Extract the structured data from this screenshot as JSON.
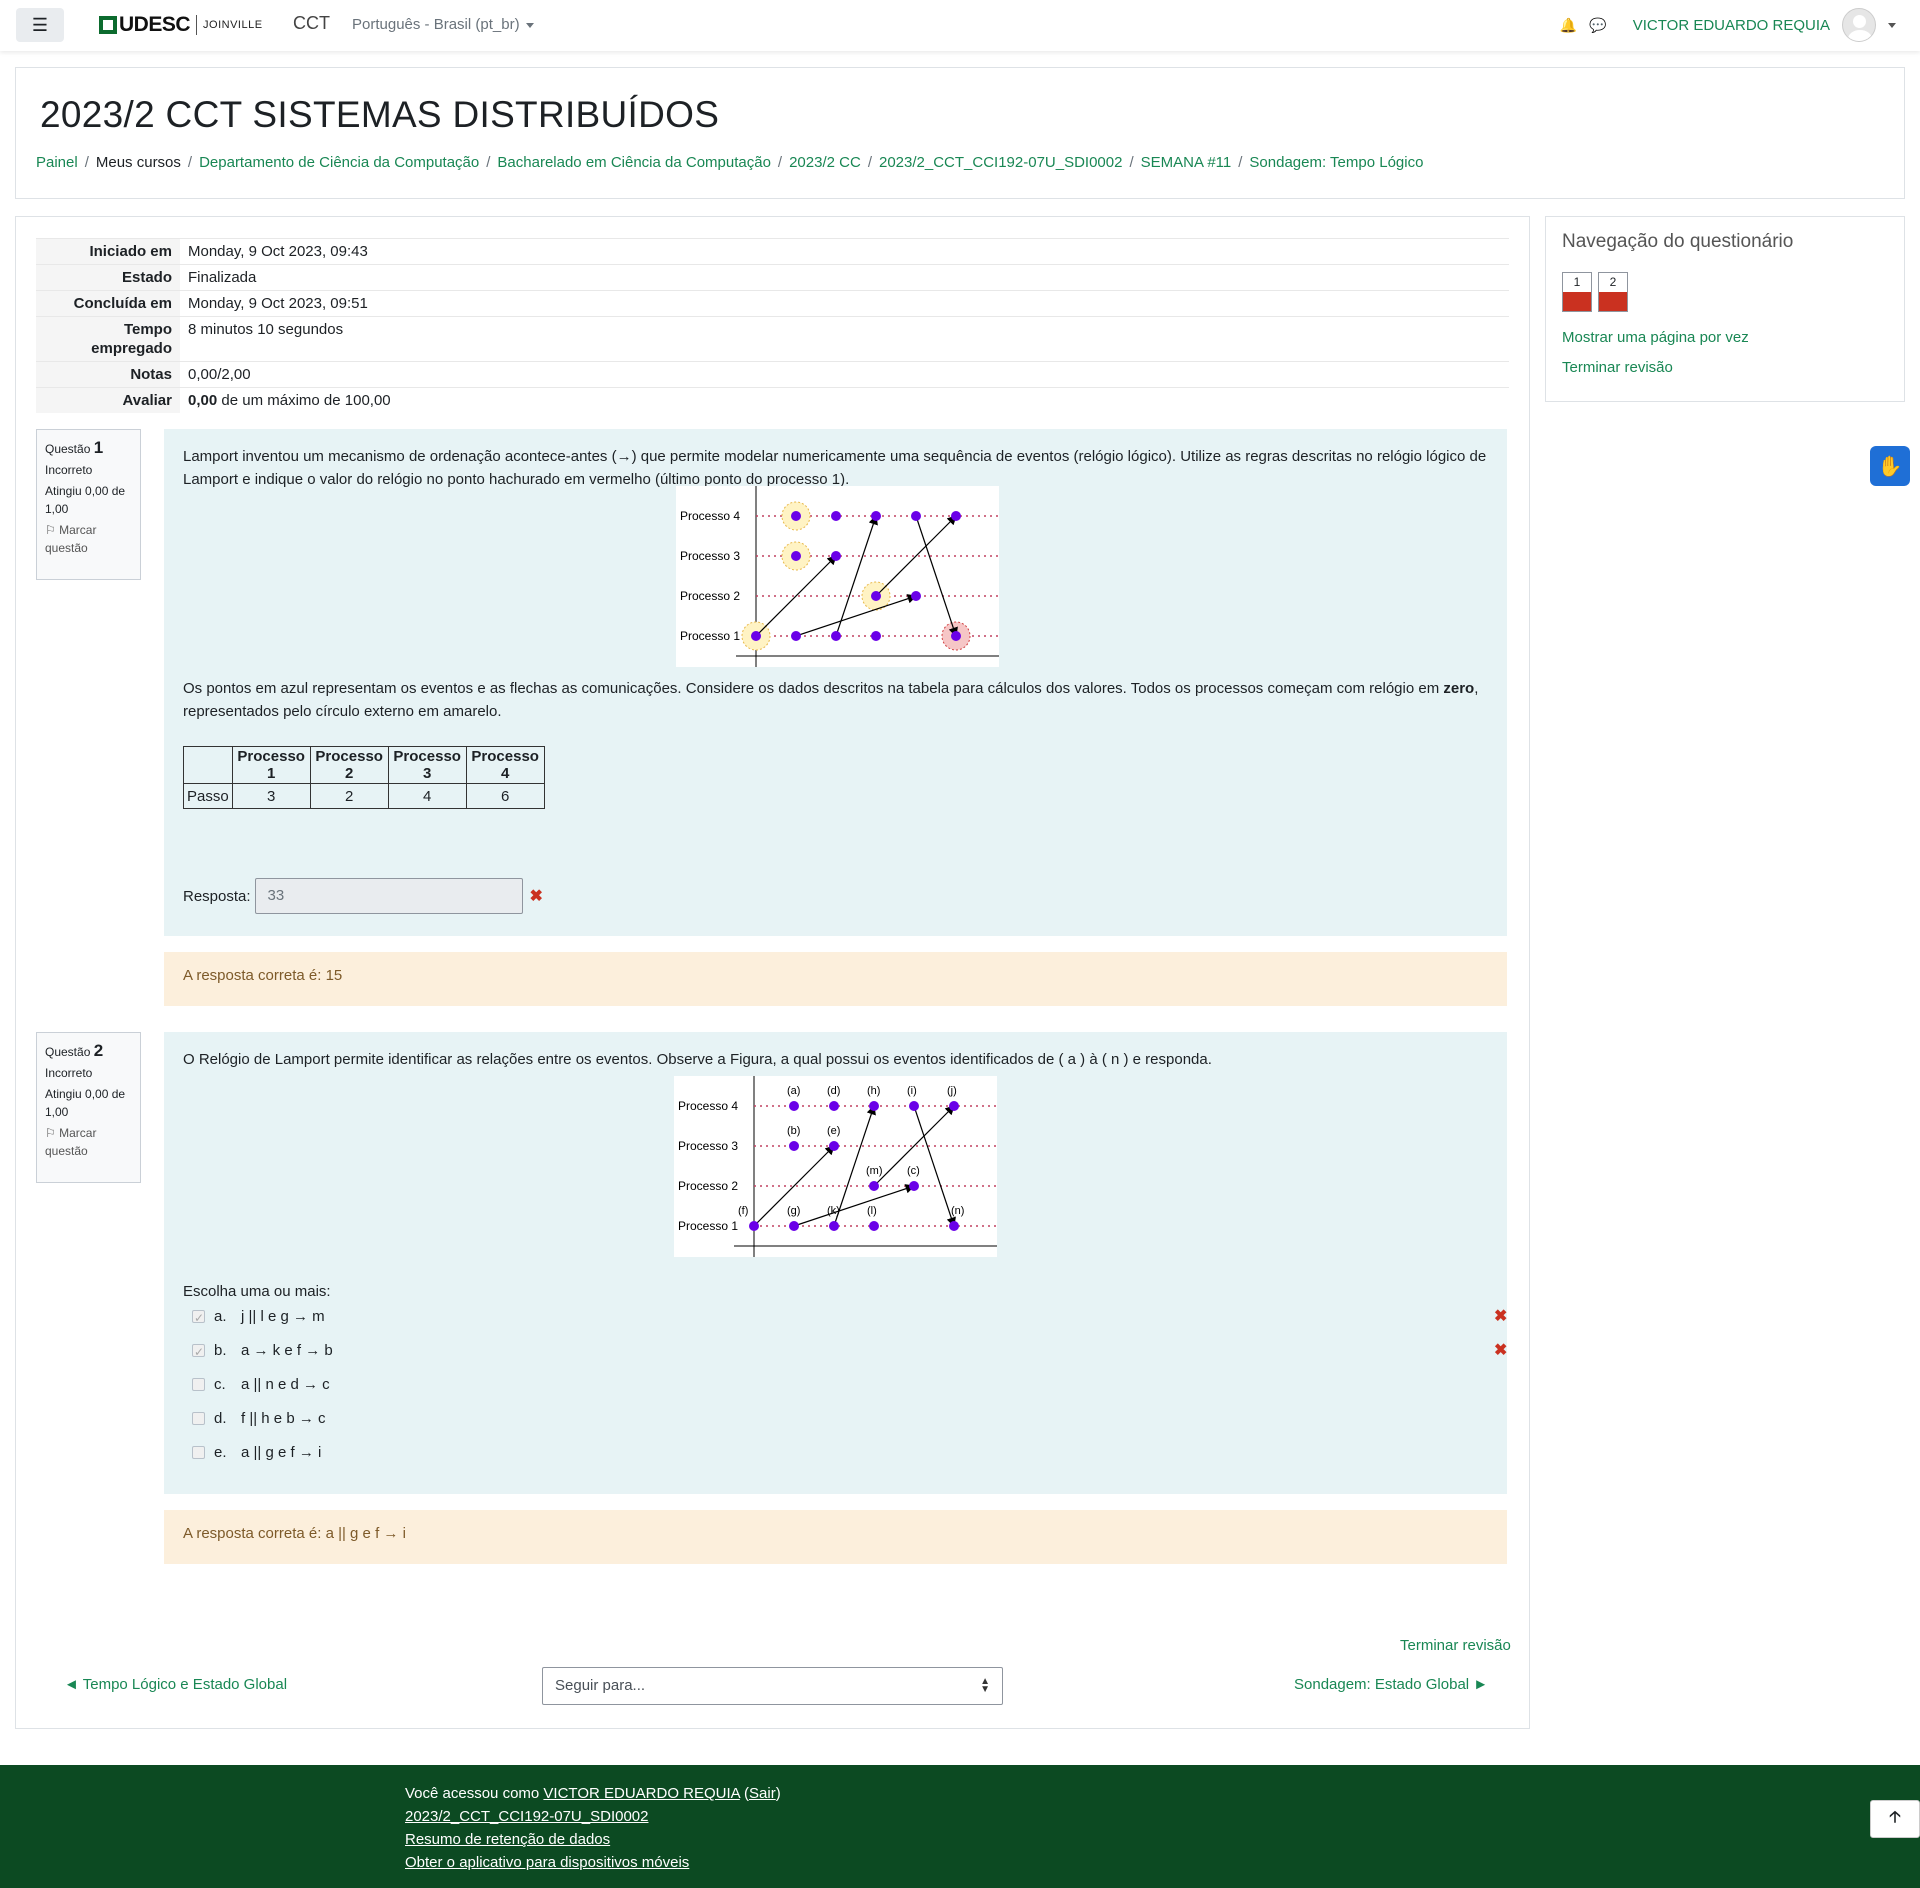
{
  "navbar": {
    "logo_text": "UDESC",
    "logo_sub": "JOINVILLE",
    "brand": "CCT",
    "language": "Português - Brasil (pt_br)",
    "user_name": "VICTOR EDUARDO REQUIA",
    "bell_glyph": "🔔",
    "chat_glyph": "💬"
  },
  "header": {
    "title": "2023/2 CCT SISTEMAS DISTRIBUÍDOS",
    "breadcrumb": [
      "Painel",
      "Meus cursos",
      "Departamento de Ciência da Computação",
      "Bacharelado em Ciência da Computação",
      "2023/2 CC",
      "2023/2_CCT_CCI192-07U_SDI0002",
      "SEMANA #11",
      "Sondagem: Tempo Lógico"
    ]
  },
  "summary": [
    {
      "label": "Iniciado em",
      "value": "Monday, 9 Oct 2023, 09:43"
    },
    {
      "label": "Estado",
      "value": "Finalizada"
    },
    {
      "label": "Concluída em",
      "value": "Monday, 9 Oct 2023, 09:51"
    },
    {
      "label": "Tempo empregado",
      "value": "8 minutos 10 segundos"
    },
    {
      "label": "Notas",
      "value": "0,00/2,00"
    },
    {
      "label": "Avaliar",
      "value_bold": "0,00",
      "value_rest": " de um máximo de 100,00"
    }
  ],
  "question1": {
    "prefix": "Questão",
    "number": "1",
    "status": "Incorreto",
    "grade": "Atingiu 0,00 de 1,00",
    "flag": "Marcar questão",
    "text1": "Lamport inventou um mecanismo de ordenação acontece-antes (→) que permite modelar numericamente uma sequência de eventos (relógio lógico). Utilize as regras descritas no relógio lógico de Lamport e indique o valor do relógio no ponto hachurado em vermelho (último ponto do processo 1).",
    "text2_a": "Os pontos em azul representam os eventos e as flechas as comunicações. Considere os dados descritos na tabela para cálculos dos valores. Todos os processos começam com relógio em ",
    "text2_bold": "zero",
    "text2_b": ", representados pelo círculo externo em amarelo.",
    "table_headers": [
      "",
      "Processo 1",
      "Processo 2",
      "Processo 3",
      "Processo 4"
    ],
    "table_row": [
      "Passo",
      "3",
      "2",
      "4",
      "6"
    ],
    "answer_label": "Resposta:",
    "answer_value": "33",
    "feedback": "A resposta correta é: 15"
  },
  "question2": {
    "prefix": "Questão",
    "number": "2",
    "status": "Incorreto",
    "grade": "Atingiu 0,00 de 1,00",
    "flag": "Marcar questão",
    "text": "O Relógio de Lamport permite identificar as relações entre os eventos. Observe a Figura, a qual possui os eventos identificados de ( a ) à ( n ) e responda.",
    "prompt": "Escolha uma ou mais:",
    "choices": [
      {
        "letter": "a.",
        "text": "j || l e g → m",
        "checked": true,
        "wrong": true
      },
      {
        "letter": "b.",
        "text": "a → k e f → b",
        "checked": true,
        "wrong": true
      },
      {
        "letter": "c.",
        "text": "a || n e d → c",
        "checked": false,
        "wrong": false
      },
      {
        "letter": "d.",
        "text": "f || h e b → c",
        "checked": false,
        "wrong": false
      },
      {
        "letter": "e.",
        "text": "a || g e f → i",
        "checked": false,
        "wrong": false
      }
    ],
    "feedback": "A resposta correta é: a || g e f → i"
  },
  "diagram": {
    "process_labels": [
      "Processo 4",
      "Processo 3",
      "Processo 2",
      "Processo 1"
    ],
    "event_labels_p4": [
      "(a)",
      "(d)",
      "(h)",
      "(i)",
      "(j)"
    ],
    "event_labels_p3": [
      "(b)",
      "(e)"
    ],
    "event_labels_p2": [
      "(m)",
      "(c)"
    ],
    "event_labels_p1": [
      "(f)",
      "(g)",
      "(k)",
      "(l)",
      "(n)"
    ],
    "event_color": "#6a00e8",
    "arrow_color": "#000000",
    "dotted_color": "#c04060"
  },
  "bottom_nav": {
    "finish_review": "Terminar revisão",
    "prev_link": "◄ Tempo Lógico e Estado Global",
    "jump_placeholder": "Seguir para...",
    "next_link": "Sondagem: Estado Global ►"
  },
  "side_nav": {
    "title": "Navegação do questionário",
    "buttons": [
      "1",
      "2"
    ],
    "show_one_page": "Mostrar uma página por vez",
    "finish_review": "Terminar revisão"
  },
  "footer": {
    "logged_as_prefix": "Você acessou como ",
    "user_name": "VICTOR EDUARDO REQUIA",
    "logout": "Sair",
    "course_link": "2023/2_CCT_CCI192-07U_SDI0002",
    "retention": "Resumo de retenção de dados",
    "mobile_app": "Obter o aplicativo para dispositivos móveis",
    "to_top_glyph": "🡡"
  },
  "colors": {
    "accent_green": "#198754",
    "footer_bg": "#0c4a22",
    "question_bg": "#e7f3f5",
    "feedback_bg": "#fcefdc",
    "incorrect_red": "#ca3120"
  }
}
